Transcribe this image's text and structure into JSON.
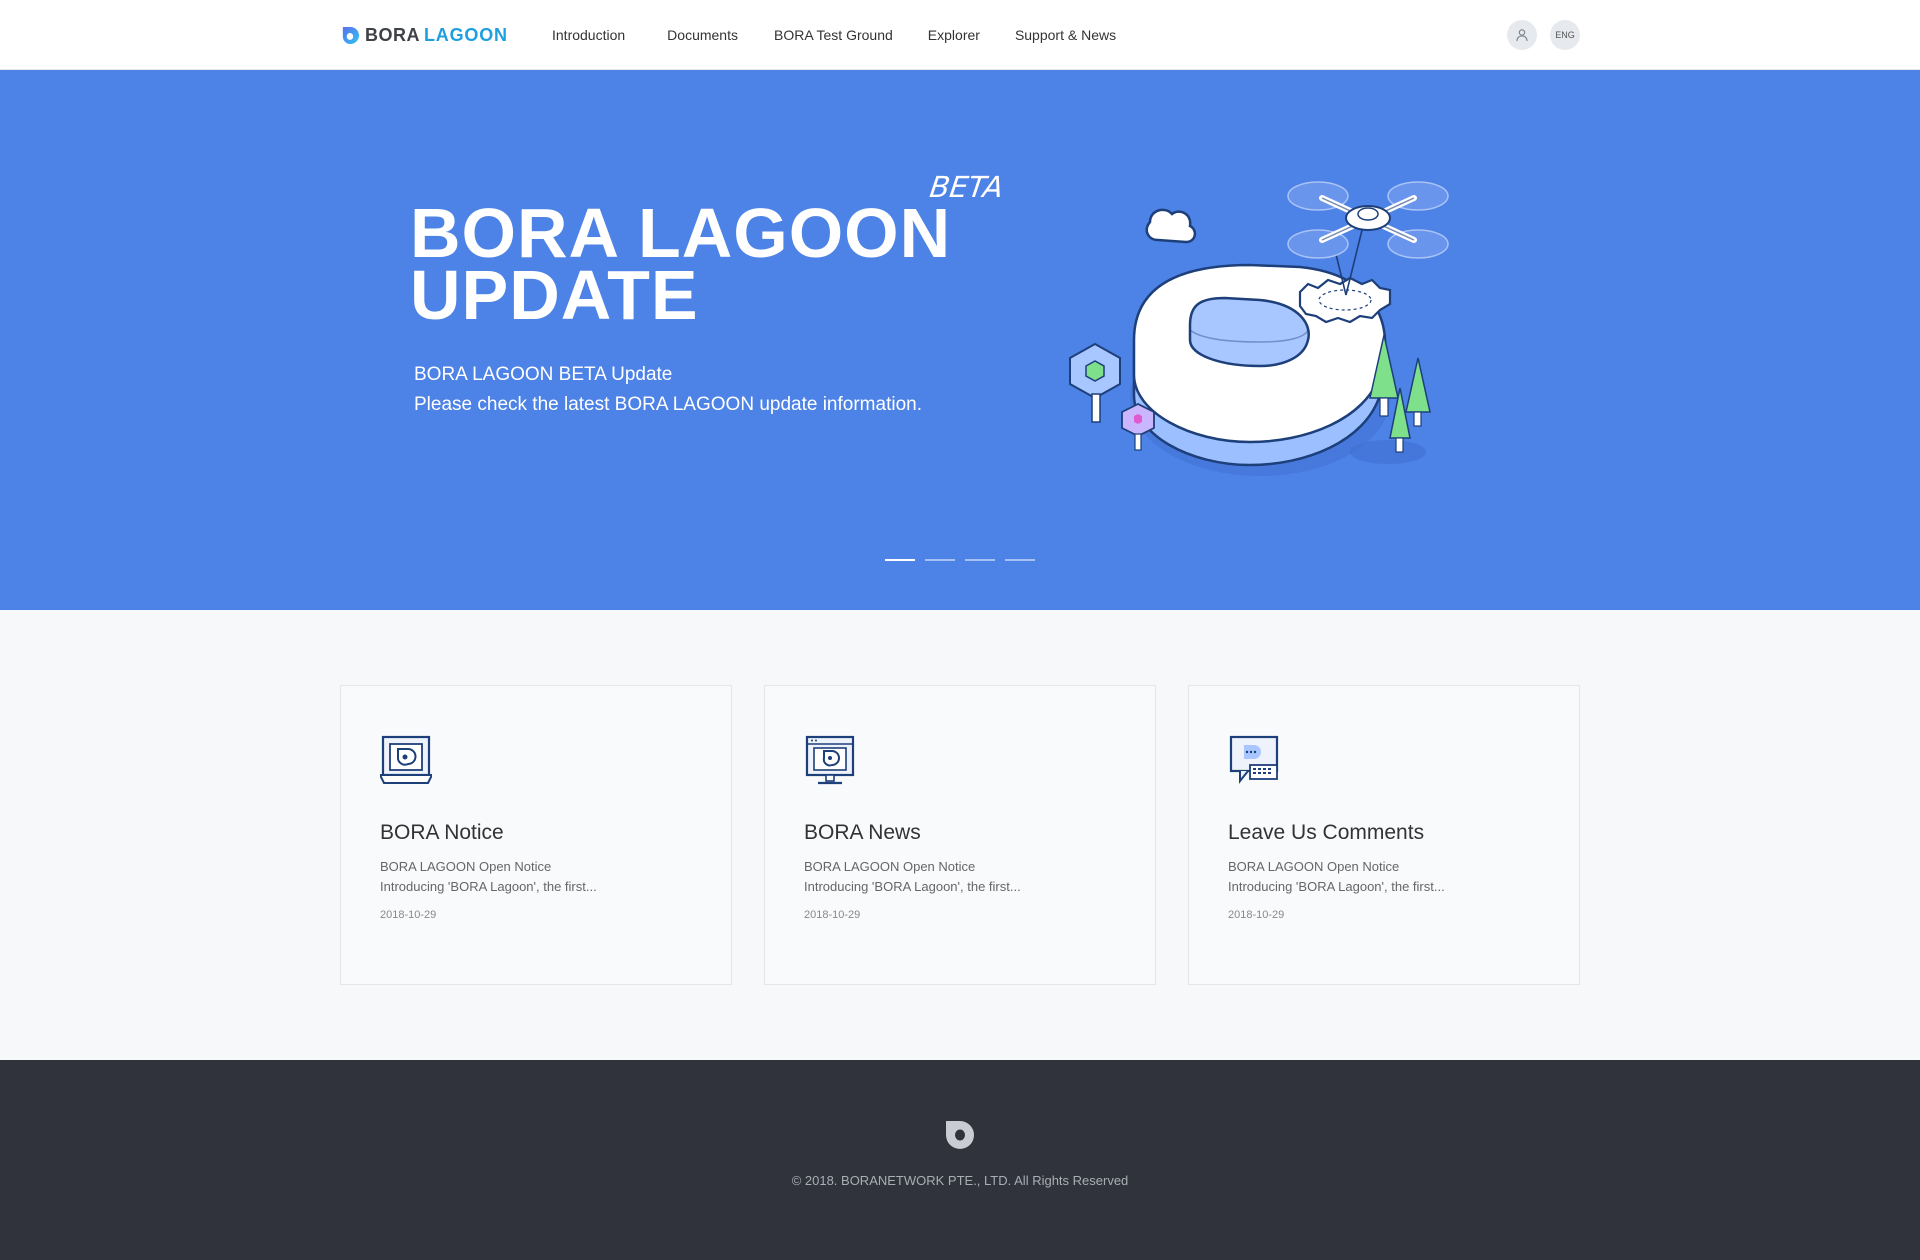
{
  "header": {
    "logo_bora": "BORA",
    "logo_lagoon": "LAGOON",
    "nav": [
      "Introduction",
      "Documents",
      "BORA Test Ground",
      "Explorer",
      "Support & News"
    ],
    "user_icon": "user-icon",
    "lang_label": "ENG"
  },
  "hero": {
    "beta_tag": "BETA",
    "title_line1": "BORA LAGOON",
    "title_line2": "UPDATE",
    "subtitle_line1": "BORA LAGOON BETA Update",
    "subtitle_line2": "Please check the latest BORA LAGOON update information.",
    "slide_count": 4,
    "active_slide": 1,
    "background_color": "#4d82e6"
  },
  "cards": [
    {
      "icon": "notice-icon",
      "title": "BORA Notice",
      "line1": "BORA LAGOON Open Notice",
      "line2": "Introducing 'BORA Lagoon', the first...",
      "date": "2018-10-29"
    },
    {
      "icon": "news-icon",
      "title": "BORA News",
      "line1": "BORA LAGOON Open Notice",
      "line2": "Introducing 'BORA Lagoon', the first...",
      "date": "2018-10-29"
    },
    {
      "icon": "comments-icon",
      "title": "Leave Us Comments",
      "line1": "BORA LAGOON Open Notice",
      "line2": "Introducing 'BORA Lagoon', the first...",
      "date": "2018-10-29"
    }
  ],
  "footer": {
    "copyright": "© 2018. BORANETWORK PTE., LTD. All Rights Reserved"
  }
}
